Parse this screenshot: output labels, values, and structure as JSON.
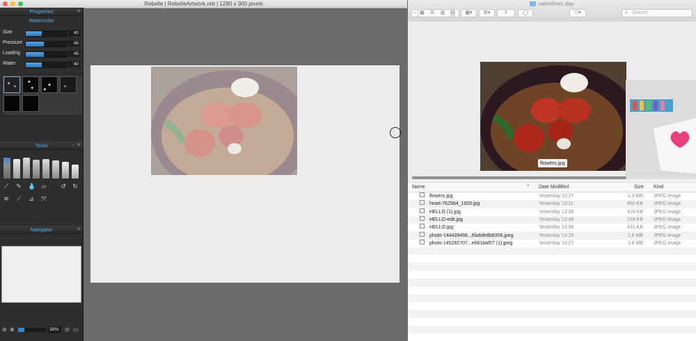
{
  "rebelle": {
    "window_title": "Rebelle | RebelleArtwork.reb | 1280 x 900 pixels",
    "properties": {
      "header": "Properties",
      "brush_type": "Watercolor",
      "sliders": [
        {
          "label": "Size",
          "value": "40",
          "fraction": 0.4
        },
        {
          "label": "Pressure",
          "value": "45",
          "fraction": 0.45
        },
        {
          "label": "Loading",
          "value": "45",
          "fraction": 0.45
        },
        {
          "label": "Water",
          "value": "40",
          "fraction": 0.4
        }
      ]
    },
    "tools": {
      "header": "Tools"
    },
    "navigator": {
      "header": "Navigator",
      "zoom": "58%"
    }
  },
  "finder": {
    "window_title": "valentines day",
    "search_placeholder": "Search",
    "preview_label": "flowers.jpg",
    "columns": {
      "name": "Name",
      "date": "Date Modified",
      "size": "Size",
      "kind": "Kind"
    },
    "files": [
      {
        "name": "flowers.jpg",
        "date": "Yesterday 13:27",
        "size": "1,3 MB",
        "kind": "JPEG image"
      },
      {
        "name": "heart-762564_1920.jpg",
        "date": "Yesterday 13:11",
        "size": "450 KB",
        "kind": "JPEG image"
      },
      {
        "name": "HELLO (1).jpg",
        "date": "Yesterday 13:38",
        "size": "428 KB",
        "kind": "JPEG image"
      },
      {
        "name": "HELLO-edit.jpg",
        "date": "Yesterday 13:39",
        "size": "159 KB",
        "kind": "JPEG image"
      },
      {
        "name": "HELLO.jpg",
        "date": "Yesterday 13:36",
        "size": "431 KB",
        "kind": "JPEG image"
      },
      {
        "name": "photo-144439466...6fa6de8b8356.jpeg",
        "date": "Yesterday 13:29",
        "size": "1,6 MB",
        "kind": "JPEG image"
      },
      {
        "name": "photo-145282707...e661baf57 (1).jpeg",
        "date": "Yesterday 13:27",
        "size": "3,8 MB",
        "kind": "JPEG image"
      }
    ]
  },
  "colors": {
    "accent": "#57b1f2",
    "panel_bg": "#2e2e2e",
    "workspace": "#6b6b6b"
  }
}
